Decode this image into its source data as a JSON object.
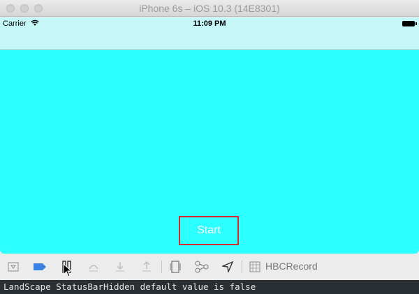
{
  "window": {
    "title": "iPhone 6s – iOS 10.3 (14E8301)"
  },
  "status_bar": {
    "carrier": "Carrier",
    "time": "11:09 PM"
  },
  "main": {
    "start_button": "Start"
  },
  "toolbar": {
    "scheme_label": "HBCRecord"
  },
  "console": {
    "log_line": "LandScape StatusBarHidden default value is false"
  },
  "colors": {
    "screen_bg": "#2bffff",
    "navbar_bg": "#c5f6f8",
    "button_border": "#d82b2b",
    "console_bg": "#2a2f33"
  }
}
